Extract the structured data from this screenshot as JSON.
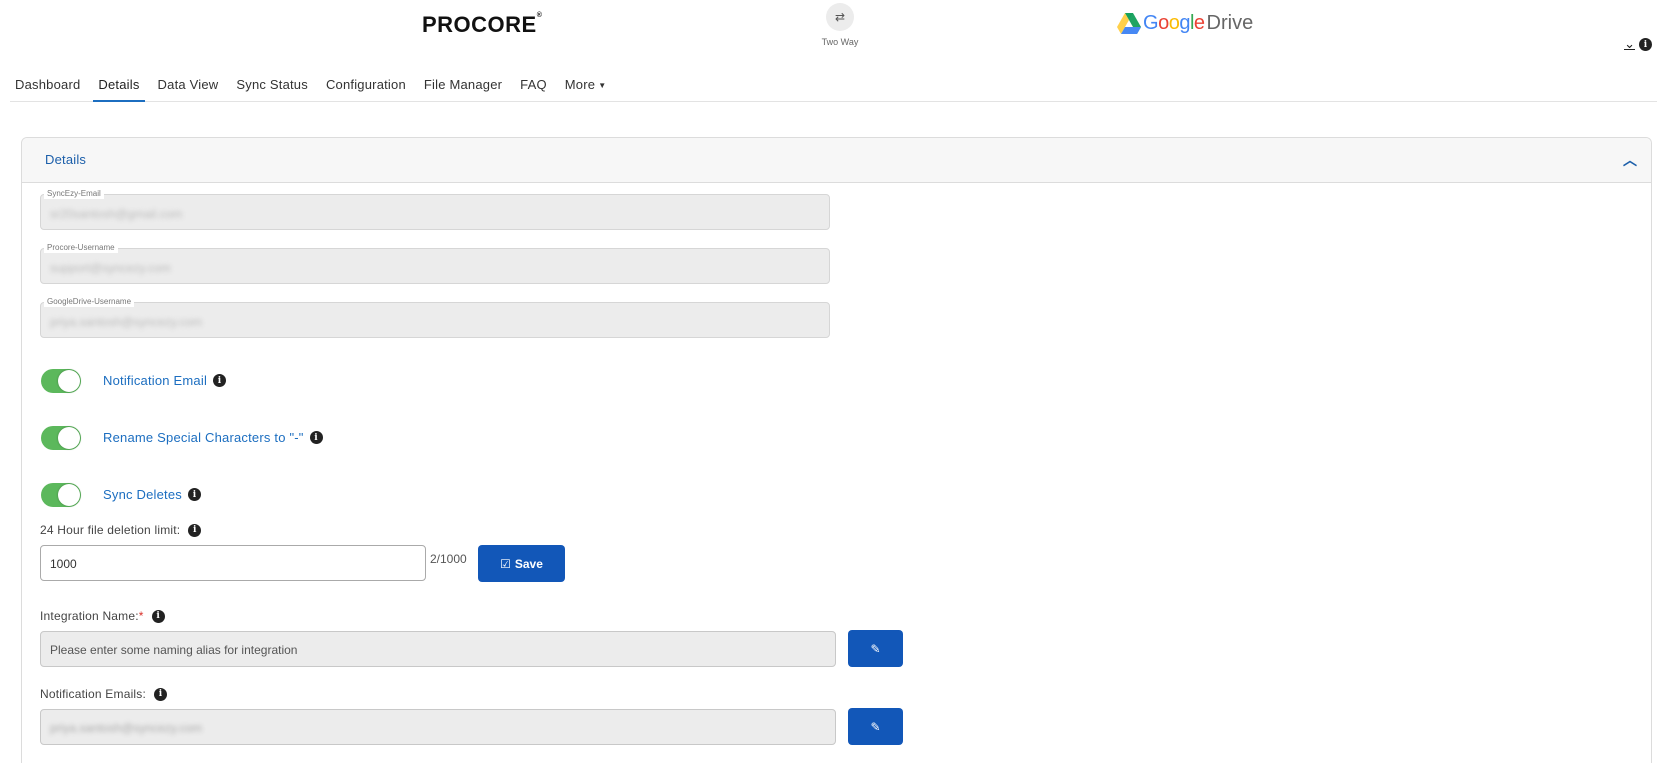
{
  "header": {
    "left_logo": "PROCORE",
    "sync_mode_label": "Two Way",
    "right_logo_google": "Google",
    "right_logo_drive": "Drive"
  },
  "tabs": [
    {
      "label": "Dashboard",
      "active": false
    },
    {
      "label": "Details",
      "active": true
    },
    {
      "label": "Data View",
      "active": false
    },
    {
      "label": "Sync Status",
      "active": false
    },
    {
      "label": "Configuration",
      "active": false
    },
    {
      "label": "File Manager",
      "active": false
    },
    {
      "label": "FAQ",
      "active": false
    },
    {
      "label": "More",
      "active": false
    }
  ],
  "panel": {
    "title": "Details",
    "fields": {
      "syncezy_email": {
        "label": "SyncEzy-Email",
        "value": "sr20santosh@gmail.com"
      },
      "procore_username": {
        "label": "Procore-Username",
        "value": "support@syncezy.com"
      },
      "gdrive_username": {
        "label": "GoogleDrive-Username",
        "value": "priya.santosh@syncezy.com"
      }
    },
    "toggles": {
      "notification_email": {
        "label": "Notification Email",
        "on": true
      },
      "rename_special": {
        "label": "Rename Special Characters to \"-\"",
        "on": true
      },
      "sync_deletes": {
        "label": "Sync Deletes",
        "on": true
      }
    },
    "deletion_limit": {
      "label": "24 Hour file deletion limit:",
      "value": "1000",
      "counter": "2/1000",
      "save_label": "Save"
    },
    "integration_name": {
      "label": "Integration Name:",
      "required_mark": "*",
      "placeholder": "Please enter some naming alias for integration"
    },
    "notification_emails": {
      "label": "Notification Emails:",
      "value": "priya.santosh@syncezy.com"
    }
  },
  "colors": {
    "accent": "#1c6ec0",
    "button": "#1257b8",
    "toggle_on": "#5cb85c"
  }
}
